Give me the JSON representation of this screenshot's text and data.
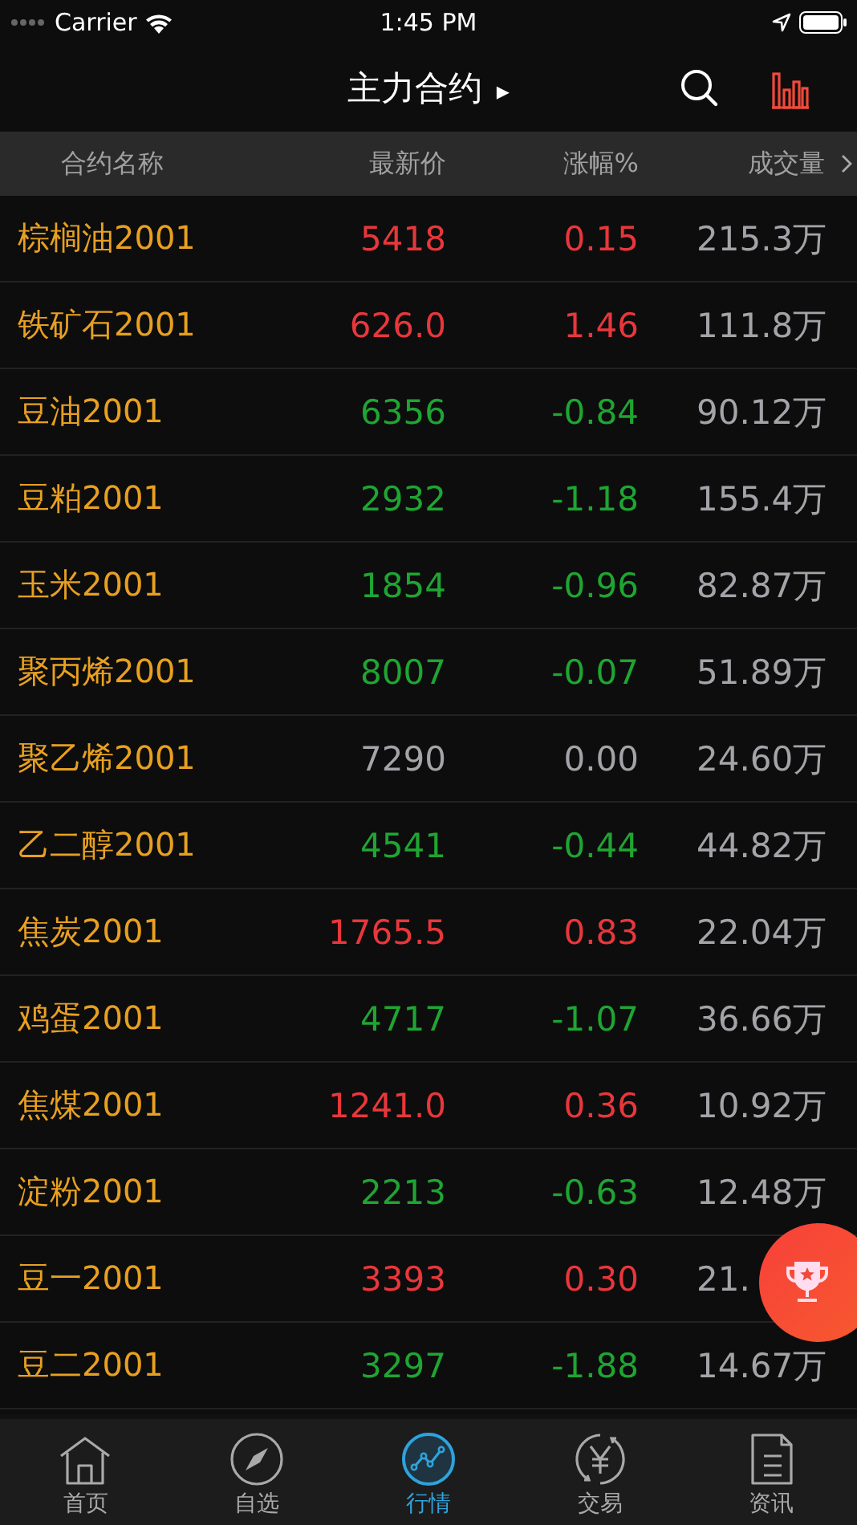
{
  "status_bar": {
    "carrier": "Carrier",
    "time": "1:45 PM"
  },
  "nav": {
    "title": "主力合约",
    "title_arrow": "▸"
  },
  "columns": [
    "合约名称",
    "最新价",
    "涨幅%",
    "成交量"
  ],
  "rows": [
    {
      "name": "棕榈油2001",
      "price": "5418",
      "change": "0.15",
      "volume": "215.3万",
      "color": "#e8373b"
    },
    {
      "name": "铁矿石2001",
      "price": "626.0",
      "change": "1.46",
      "volume": "111.8万",
      "color": "#e8373b"
    },
    {
      "name": "豆油2001",
      "price": "6356",
      "change": "-0.84",
      "volume": "90.12万",
      "color": "#1fa532"
    },
    {
      "name": "豆粕2001",
      "price": "2932",
      "change": "-1.18",
      "volume": "155.4万",
      "color": "#1fa532"
    },
    {
      "name": "玉米2001",
      "price": "1854",
      "change": "-0.96",
      "volume": "82.87万",
      "color": "#1fa532"
    },
    {
      "name": "聚丙烯2001",
      "price": "8007",
      "change": "-0.07",
      "volume": "51.89万",
      "color": "#1fa532"
    },
    {
      "name": "聚乙烯2001",
      "price": "7290",
      "change": "0.00",
      "volume": "24.60万",
      "color": "#a3a3a8"
    },
    {
      "name": "乙二醇2001",
      "price": "4541",
      "change": "-0.44",
      "volume": "44.82万",
      "color": "#1fa532"
    },
    {
      "name": "焦炭2001",
      "price": "1765.5",
      "change": "0.83",
      "volume": "22.04万",
      "color": "#e8373b"
    },
    {
      "name": "鸡蛋2001",
      "price": "4717",
      "change": "-1.07",
      "volume": "36.66万",
      "color": "#1fa532"
    },
    {
      "name": "焦煤2001",
      "price": "1241.0",
      "change": "0.36",
      "volume": "10.92万",
      "color": "#e8373b"
    },
    {
      "name": "淀粉2001",
      "price": "2213",
      "change": "-0.63",
      "volume": "12.48万",
      "color": "#1fa532"
    },
    {
      "name": "豆一2001",
      "price": "3393",
      "change": "0.30",
      "volume": "21.",
      "color": "#e8373b"
    },
    {
      "name": "豆二2001",
      "price": "3297",
      "change": "-1.88",
      "volume": "14.67万",
      "color": "#1fa532"
    }
  ],
  "tabs": [
    {
      "label": "首页",
      "kind": "home",
      "selected": false
    },
    {
      "label": "自选",
      "kind": "compass",
      "selected": false
    },
    {
      "label": "行情",
      "kind": "chart",
      "selected": true
    },
    {
      "label": "交易",
      "kind": "trade",
      "selected": false
    },
    {
      "label": "资讯",
      "kind": "news",
      "selected": false
    }
  ]
}
